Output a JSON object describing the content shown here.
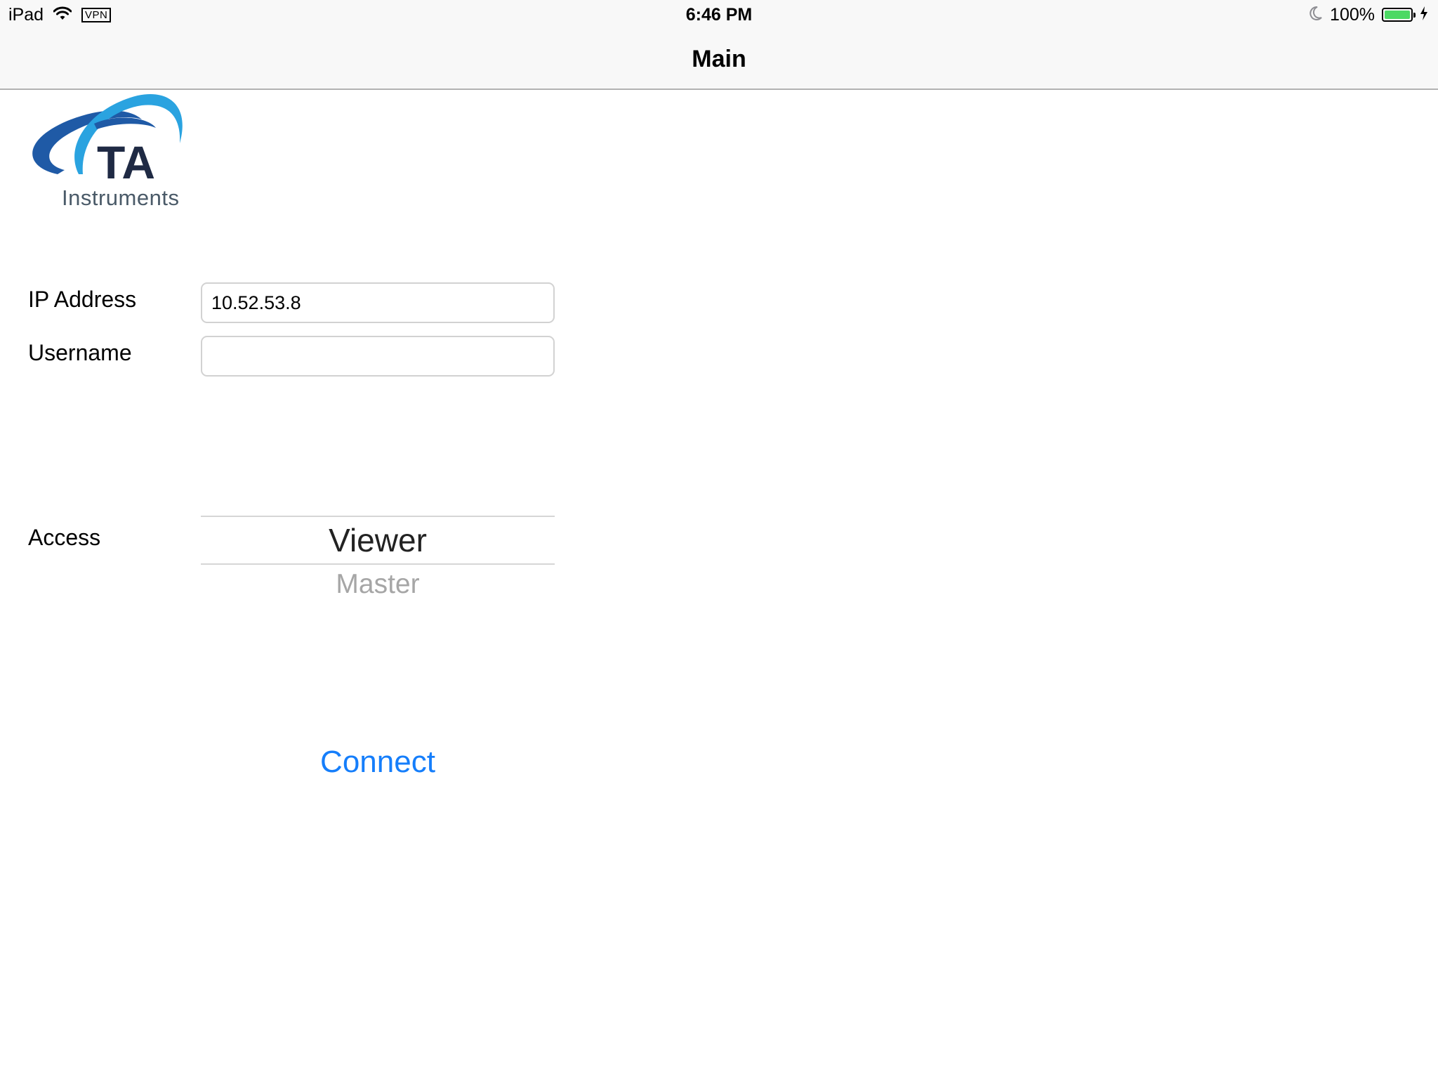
{
  "status_bar": {
    "device": "iPad",
    "vpn": "VPN",
    "time": "6:46 PM",
    "battery_text": "100%",
    "battery_level": 1.0,
    "battery_color": "#4cd964"
  },
  "nav": {
    "title": "Main"
  },
  "logo": {
    "mark_text": "TA",
    "wordmark": "Instruments"
  },
  "form": {
    "ip": {
      "label": "IP Address",
      "value": "10.52.53.8",
      "placeholder": ""
    },
    "username": {
      "label": "Username",
      "value": "",
      "placeholder": ""
    },
    "access": {
      "label": "Access",
      "selected": "Viewer",
      "options": [
        "Viewer",
        "Master"
      ]
    }
  },
  "actions": {
    "connect_label": "Connect",
    "accent_color": "#157efb"
  }
}
